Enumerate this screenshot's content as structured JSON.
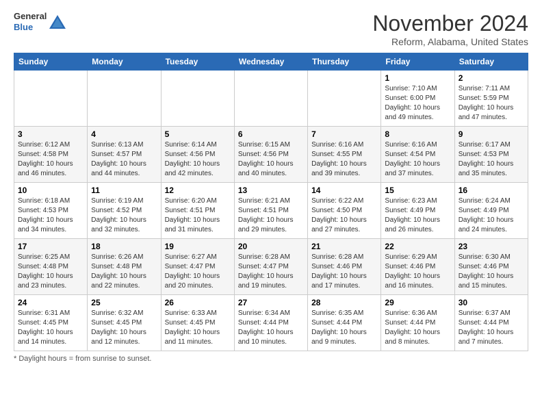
{
  "header": {
    "logo_line1": "General",
    "logo_line2": "Blue",
    "month_title": "November 2024",
    "location": "Reform, Alabama, United States"
  },
  "footer": {
    "note": "Daylight hours"
  },
  "weekdays": [
    "Sunday",
    "Monday",
    "Tuesday",
    "Wednesday",
    "Thursday",
    "Friday",
    "Saturday"
  ],
  "weeks": [
    [
      {
        "day": "",
        "info": ""
      },
      {
        "day": "",
        "info": ""
      },
      {
        "day": "",
        "info": ""
      },
      {
        "day": "",
        "info": ""
      },
      {
        "day": "",
        "info": ""
      },
      {
        "day": "1",
        "info": "Sunrise: 7:10 AM\nSunset: 6:00 PM\nDaylight: 10 hours\nand 49 minutes."
      },
      {
        "day": "2",
        "info": "Sunrise: 7:11 AM\nSunset: 5:59 PM\nDaylight: 10 hours\nand 47 minutes."
      }
    ],
    [
      {
        "day": "3",
        "info": "Sunrise: 6:12 AM\nSunset: 4:58 PM\nDaylight: 10 hours\nand 46 minutes."
      },
      {
        "day": "4",
        "info": "Sunrise: 6:13 AM\nSunset: 4:57 PM\nDaylight: 10 hours\nand 44 minutes."
      },
      {
        "day": "5",
        "info": "Sunrise: 6:14 AM\nSunset: 4:56 PM\nDaylight: 10 hours\nand 42 minutes."
      },
      {
        "day": "6",
        "info": "Sunrise: 6:15 AM\nSunset: 4:56 PM\nDaylight: 10 hours\nand 40 minutes."
      },
      {
        "day": "7",
        "info": "Sunrise: 6:16 AM\nSunset: 4:55 PM\nDaylight: 10 hours\nand 39 minutes."
      },
      {
        "day": "8",
        "info": "Sunrise: 6:16 AM\nSunset: 4:54 PM\nDaylight: 10 hours\nand 37 minutes."
      },
      {
        "day": "9",
        "info": "Sunrise: 6:17 AM\nSunset: 4:53 PM\nDaylight: 10 hours\nand 35 minutes."
      }
    ],
    [
      {
        "day": "10",
        "info": "Sunrise: 6:18 AM\nSunset: 4:53 PM\nDaylight: 10 hours\nand 34 minutes."
      },
      {
        "day": "11",
        "info": "Sunrise: 6:19 AM\nSunset: 4:52 PM\nDaylight: 10 hours\nand 32 minutes."
      },
      {
        "day": "12",
        "info": "Sunrise: 6:20 AM\nSunset: 4:51 PM\nDaylight: 10 hours\nand 31 minutes."
      },
      {
        "day": "13",
        "info": "Sunrise: 6:21 AM\nSunset: 4:51 PM\nDaylight: 10 hours\nand 29 minutes."
      },
      {
        "day": "14",
        "info": "Sunrise: 6:22 AM\nSunset: 4:50 PM\nDaylight: 10 hours\nand 27 minutes."
      },
      {
        "day": "15",
        "info": "Sunrise: 6:23 AM\nSunset: 4:49 PM\nDaylight: 10 hours\nand 26 minutes."
      },
      {
        "day": "16",
        "info": "Sunrise: 6:24 AM\nSunset: 4:49 PM\nDaylight: 10 hours\nand 24 minutes."
      }
    ],
    [
      {
        "day": "17",
        "info": "Sunrise: 6:25 AM\nSunset: 4:48 PM\nDaylight: 10 hours\nand 23 minutes."
      },
      {
        "day": "18",
        "info": "Sunrise: 6:26 AM\nSunset: 4:48 PM\nDaylight: 10 hours\nand 22 minutes."
      },
      {
        "day": "19",
        "info": "Sunrise: 6:27 AM\nSunset: 4:47 PM\nDaylight: 10 hours\nand 20 minutes."
      },
      {
        "day": "20",
        "info": "Sunrise: 6:28 AM\nSunset: 4:47 PM\nDaylight: 10 hours\nand 19 minutes."
      },
      {
        "day": "21",
        "info": "Sunrise: 6:28 AM\nSunset: 4:46 PM\nDaylight: 10 hours\nand 17 minutes."
      },
      {
        "day": "22",
        "info": "Sunrise: 6:29 AM\nSunset: 4:46 PM\nDaylight: 10 hours\nand 16 minutes."
      },
      {
        "day": "23",
        "info": "Sunrise: 6:30 AM\nSunset: 4:46 PM\nDaylight: 10 hours\nand 15 minutes."
      }
    ],
    [
      {
        "day": "24",
        "info": "Sunrise: 6:31 AM\nSunset: 4:45 PM\nDaylight: 10 hours\nand 14 minutes."
      },
      {
        "day": "25",
        "info": "Sunrise: 6:32 AM\nSunset: 4:45 PM\nDaylight: 10 hours\nand 12 minutes."
      },
      {
        "day": "26",
        "info": "Sunrise: 6:33 AM\nSunset: 4:45 PM\nDaylight: 10 hours\nand 11 minutes."
      },
      {
        "day": "27",
        "info": "Sunrise: 6:34 AM\nSunset: 4:44 PM\nDaylight: 10 hours\nand 10 minutes."
      },
      {
        "day": "28",
        "info": "Sunrise: 6:35 AM\nSunset: 4:44 PM\nDaylight: 10 hours\nand 9 minutes."
      },
      {
        "day": "29",
        "info": "Sunrise: 6:36 AM\nSunset: 4:44 PM\nDaylight: 10 hours\nand 8 minutes."
      },
      {
        "day": "30",
        "info": "Sunrise: 6:37 AM\nSunset: 4:44 PM\nDaylight: 10 hours\nand 7 minutes."
      }
    ]
  ]
}
